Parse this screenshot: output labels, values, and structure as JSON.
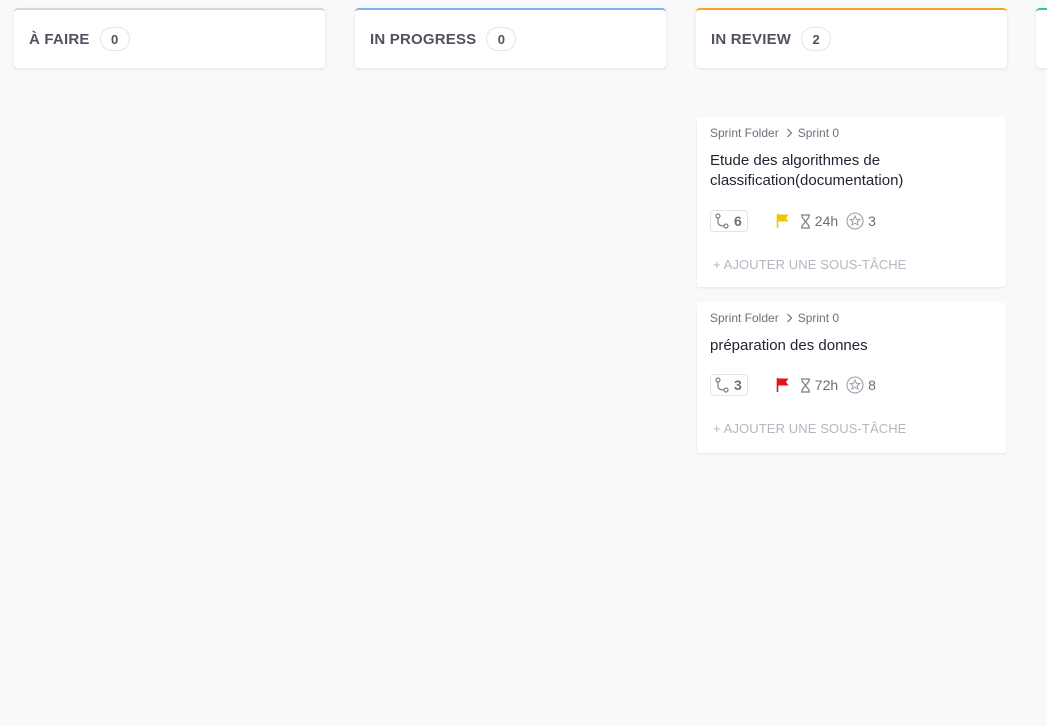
{
  "columns": [
    {
      "title": "À FAIRE",
      "count": "0",
      "color": "#d0d0d0"
    },
    {
      "title": "IN PROGRESS",
      "count": "0",
      "color": "#5b9cf6"
    },
    {
      "title": "IN REVIEW",
      "count": "2",
      "color": "#f5a623"
    },
    {
      "title": "",
      "count": "",
      "color": "#2ec4a5"
    }
  ],
  "cards": [
    {
      "folder": "Sprint Folder",
      "sprint": "Sprint 0",
      "title": "Etude des algorithmes de classification(documentation)",
      "subtasks": "6",
      "flag_icon": "flag-yellow-icon",
      "flag_color": "#f5c400",
      "time": "24h",
      "points": "3",
      "add_subtask": "+ AJOUTER UNE SOUS-TÂCHE"
    },
    {
      "folder": "Sprint Folder",
      "sprint": "Sprint 0",
      "title": "préparation des donnes",
      "subtasks": "3",
      "flag_icon": "flag-red-icon",
      "flag_color": "#e5141c",
      "time": "72h",
      "points": "8",
      "add_subtask": "+ AJOUTER UNE SOUS-TÂCHE"
    }
  ]
}
